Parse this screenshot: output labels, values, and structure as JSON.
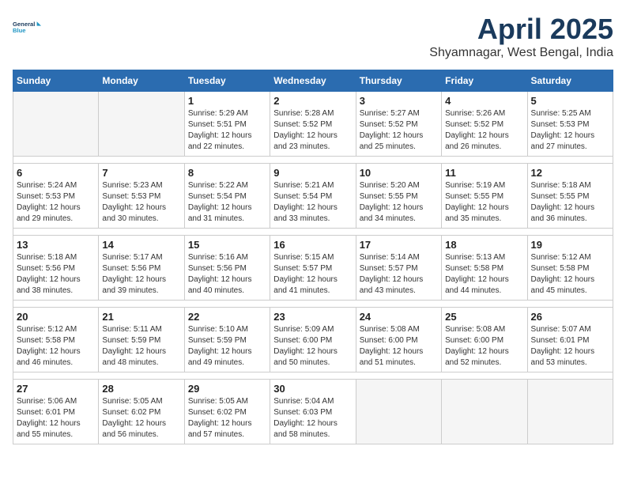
{
  "logo": {
    "line1": "General",
    "line2": "Blue"
  },
  "title": "April 2025",
  "subtitle": "Shyamnagar, West Bengal, India",
  "weekdays": [
    "Sunday",
    "Monday",
    "Tuesday",
    "Wednesday",
    "Thursday",
    "Friday",
    "Saturday"
  ],
  "weeks": [
    [
      {
        "day": "",
        "sunrise": "",
        "sunset": "",
        "daylight": ""
      },
      {
        "day": "",
        "sunrise": "",
        "sunset": "",
        "daylight": ""
      },
      {
        "day": "1",
        "sunrise": "Sunrise: 5:29 AM",
        "sunset": "Sunset: 5:51 PM",
        "daylight": "Daylight: 12 hours and 22 minutes."
      },
      {
        "day": "2",
        "sunrise": "Sunrise: 5:28 AM",
        "sunset": "Sunset: 5:52 PM",
        "daylight": "Daylight: 12 hours and 23 minutes."
      },
      {
        "day": "3",
        "sunrise": "Sunrise: 5:27 AM",
        "sunset": "Sunset: 5:52 PM",
        "daylight": "Daylight: 12 hours and 25 minutes."
      },
      {
        "day": "4",
        "sunrise": "Sunrise: 5:26 AM",
        "sunset": "Sunset: 5:52 PM",
        "daylight": "Daylight: 12 hours and 26 minutes."
      },
      {
        "day": "5",
        "sunrise": "Sunrise: 5:25 AM",
        "sunset": "Sunset: 5:53 PM",
        "daylight": "Daylight: 12 hours and 27 minutes."
      }
    ],
    [
      {
        "day": "6",
        "sunrise": "Sunrise: 5:24 AM",
        "sunset": "Sunset: 5:53 PM",
        "daylight": "Daylight: 12 hours and 29 minutes."
      },
      {
        "day": "7",
        "sunrise": "Sunrise: 5:23 AM",
        "sunset": "Sunset: 5:53 PM",
        "daylight": "Daylight: 12 hours and 30 minutes."
      },
      {
        "day": "8",
        "sunrise": "Sunrise: 5:22 AM",
        "sunset": "Sunset: 5:54 PM",
        "daylight": "Daylight: 12 hours and 31 minutes."
      },
      {
        "day": "9",
        "sunrise": "Sunrise: 5:21 AM",
        "sunset": "Sunset: 5:54 PM",
        "daylight": "Daylight: 12 hours and 33 minutes."
      },
      {
        "day": "10",
        "sunrise": "Sunrise: 5:20 AM",
        "sunset": "Sunset: 5:55 PM",
        "daylight": "Daylight: 12 hours and 34 minutes."
      },
      {
        "day": "11",
        "sunrise": "Sunrise: 5:19 AM",
        "sunset": "Sunset: 5:55 PM",
        "daylight": "Daylight: 12 hours and 35 minutes."
      },
      {
        "day": "12",
        "sunrise": "Sunrise: 5:18 AM",
        "sunset": "Sunset: 5:55 PM",
        "daylight": "Daylight: 12 hours and 36 minutes."
      }
    ],
    [
      {
        "day": "13",
        "sunrise": "Sunrise: 5:18 AM",
        "sunset": "Sunset: 5:56 PM",
        "daylight": "Daylight: 12 hours and 38 minutes."
      },
      {
        "day": "14",
        "sunrise": "Sunrise: 5:17 AM",
        "sunset": "Sunset: 5:56 PM",
        "daylight": "Daylight: 12 hours and 39 minutes."
      },
      {
        "day": "15",
        "sunrise": "Sunrise: 5:16 AM",
        "sunset": "Sunset: 5:56 PM",
        "daylight": "Daylight: 12 hours and 40 minutes."
      },
      {
        "day": "16",
        "sunrise": "Sunrise: 5:15 AM",
        "sunset": "Sunset: 5:57 PM",
        "daylight": "Daylight: 12 hours and 41 minutes."
      },
      {
        "day": "17",
        "sunrise": "Sunrise: 5:14 AM",
        "sunset": "Sunset: 5:57 PM",
        "daylight": "Daylight: 12 hours and 43 minutes."
      },
      {
        "day": "18",
        "sunrise": "Sunrise: 5:13 AM",
        "sunset": "Sunset: 5:58 PM",
        "daylight": "Daylight: 12 hours and 44 minutes."
      },
      {
        "day": "19",
        "sunrise": "Sunrise: 5:12 AM",
        "sunset": "Sunset: 5:58 PM",
        "daylight": "Daylight: 12 hours and 45 minutes."
      }
    ],
    [
      {
        "day": "20",
        "sunrise": "Sunrise: 5:12 AM",
        "sunset": "Sunset: 5:58 PM",
        "daylight": "Daylight: 12 hours and 46 minutes."
      },
      {
        "day": "21",
        "sunrise": "Sunrise: 5:11 AM",
        "sunset": "Sunset: 5:59 PM",
        "daylight": "Daylight: 12 hours and 48 minutes."
      },
      {
        "day": "22",
        "sunrise": "Sunrise: 5:10 AM",
        "sunset": "Sunset: 5:59 PM",
        "daylight": "Daylight: 12 hours and 49 minutes."
      },
      {
        "day": "23",
        "sunrise": "Sunrise: 5:09 AM",
        "sunset": "Sunset: 6:00 PM",
        "daylight": "Daylight: 12 hours and 50 minutes."
      },
      {
        "day": "24",
        "sunrise": "Sunrise: 5:08 AM",
        "sunset": "Sunset: 6:00 PM",
        "daylight": "Daylight: 12 hours and 51 minutes."
      },
      {
        "day": "25",
        "sunrise": "Sunrise: 5:08 AM",
        "sunset": "Sunset: 6:00 PM",
        "daylight": "Daylight: 12 hours and 52 minutes."
      },
      {
        "day": "26",
        "sunrise": "Sunrise: 5:07 AM",
        "sunset": "Sunset: 6:01 PM",
        "daylight": "Daylight: 12 hours and 53 minutes."
      }
    ],
    [
      {
        "day": "27",
        "sunrise": "Sunrise: 5:06 AM",
        "sunset": "Sunset: 6:01 PM",
        "daylight": "Daylight: 12 hours and 55 minutes."
      },
      {
        "day": "28",
        "sunrise": "Sunrise: 5:05 AM",
        "sunset": "Sunset: 6:02 PM",
        "daylight": "Daylight: 12 hours and 56 minutes."
      },
      {
        "day": "29",
        "sunrise": "Sunrise: 5:05 AM",
        "sunset": "Sunset: 6:02 PM",
        "daylight": "Daylight: 12 hours and 57 minutes."
      },
      {
        "day": "30",
        "sunrise": "Sunrise: 5:04 AM",
        "sunset": "Sunset: 6:03 PM",
        "daylight": "Daylight: 12 hours and 58 minutes."
      },
      {
        "day": "",
        "sunrise": "",
        "sunset": "",
        "daylight": ""
      },
      {
        "day": "",
        "sunrise": "",
        "sunset": "",
        "daylight": ""
      },
      {
        "day": "",
        "sunrise": "",
        "sunset": "",
        "daylight": ""
      }
    ]
  ]
}
